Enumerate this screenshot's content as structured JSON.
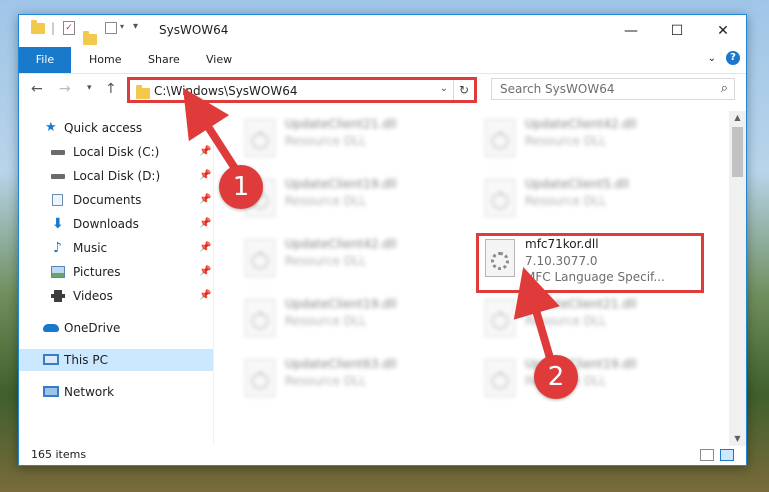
{
  "window": {
    "title": "SysWOW64",
    "controls": {
      "minimize": "—",
      "maximize": "☐",
      "close": "✕"
    }
  },
  "ribbon": {
    "tabs": [
      "File",
      "Home",
      "Share",
      "View"
    ],
    "expand_icon": "chevron-down-icon",
    "help_label": "?"
  },
  "navigation": {
    "address": "C:\\Windows\\SysWOW64",
    "search_placeholder": "Search SysWOW64",
    "refresh_glyph": "↻"
  },
  "sidebar": {
    "items": [
      {
        "label": "Quick access",
        "icon": "star-icon"
      },
      {
        "label": "Local Disk (C:)",
        "icon": "drive-icon",
        "pinned": true
      },
      {
        "label": "Local Disk (D:)",
        "icon": "drive-icon",
        "pinned": true
      },
      {
        "label": "Documents",
        "icon": "documents-icon",
        "pinned": true
      },
      {
        "label": "Downloads",
        "icon": "download-icon",
        "pinned": true
      },
      {
        "label": "Music",
        "icon": "music-icon",
        "pinned": true
      },
      {
        "label": "Pictures",
        "icon": "pictures-icon",
        "pinned": true
      },
      {
        "label": "Videos",
        "icon": "videos-icon",
        "pinned": true
      },
      {
        "label": "OneDrive",
        "icon": "cloud-icon"
      },
      {
        "label": "This PC",
        "icon": "computer-icon",
        "selected": true
      },
      {
        "label": "Network",
        "icon": "network-icon"
      }
    ]
  },
  "files": [
    {
      "name": "UpdateClient21.dll",
      "type": "Resource DLL"
    },
    {
      "name": "UpdateClient42.dll",
      "type": "Resource DLL"
    },
    {
      "name": "UpdateClient19.dll",
      "type": "Resource DLL"
    },
    {
      "name": "UpdateClient5.dll",
      "type": "Resource DLL"
    },
    {
      "name": "UpdateClient42.dll",
      "type": "Resource DLL"
    },
    {
      "name": "mfc71kor.dll",
      "version": "7.10.3077.0",
      "description": "MFC Language Specif..."
    },
    {
      "name": "UpdateClient19.dll",
      "type": "Resource DLL"
    },
    {
      "name": "UpdateClient21.dll",
      "type": "Resource DLL"
    },
    {
      "name": "UpdateClient63.dll",
      "type": "Resource DLL"
    },
    {
      "name": "UpdateClient19.dll",
      "type": "Resource DLL"
    }
  ],
  "status": {
    "item_count": "165 items"
  },
  "annotations": {
    "step1": "1",
    "step2": "2"
  },
  "colors": {
    "accent": "#1979ca",
    "highlight": "#e03b3b",
    "selected": "#cce8ff"
  }
}
